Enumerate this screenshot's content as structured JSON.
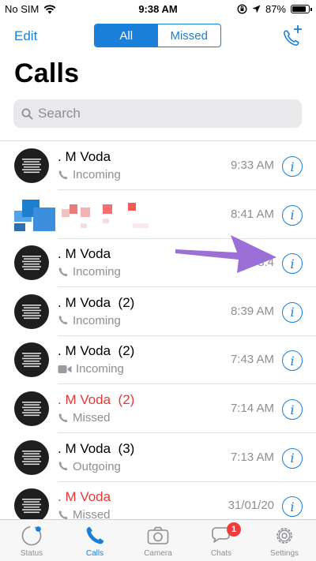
{
  "status_bar": {
    "carrier": "No SIM",
    "time": "9:38 AM",
    "battery": "87%",
    "battery_level": 0.87
  },
  "nav": {
    "edit": "Edit",
    "segments": [
      "All",
      "Missed"
    ],
    "active_segment": "All"
  },
  "title": "Calls",
  "search": {
    "placeholder": "Search"
  },
  "calls": [
    {
      "name": ". M Voda",
      "type": "Incoming",
      "time": "9:33 AM",
      "missed": false
    },
    {
      "name": "",
      "type": "",
      "time": "8:41 AM",
      "missed": false,
      "obscured": true
    },
    {
      "name": ". M Voda",
      "type": "Incoming",
      "time": "8:4",
      "missed": false
    },
    {
      "name": ". M Voda  (2)",
      "type": "Incoming",
      "time": "8:39 AM",
      "missed": false
    },
    {
      "name": ". M Voda  (2)",
      "type": "Incoming",
      "time": "7:43 AM",
      "missed": false,
      "video": true
    },
    {
      "name": ". M Voda  (2)",
      "type": "Missed",
      "time": "7:14 AM",
      "missed": true
    },
    {
      "name": ". M Voda  (3)",
      "type": "Outgoing",
      "time": "7:13 AM",
      "missed": false
    },
    {
      "name": ". M Voda",
      "type": "Missed",
      "time": "31/01/20",
      "missed": true
    }
  ],
  "tabs": [
    {
      "label": "Status",
      "icon": "status-icon"
    },
    {
      "label": "Calls",
      "icon": "phone-icon",
      "active": true
    },
    {
      "label": "Camera",
      "icon": "camera-icon"
    },
    {
      "label": "Chats",
      "icon": "chats-icon",
      "badge": "1"
    },
    {
      "label": "Settings",
      "icon": "gear-icon"
    }
  ],
  "colors": {
    "accent": "#1a7fd9",
    "missed": "#e53935",
    "arrow": "#9b6fd6",
    "badge": "#f23b3b"
  }
}
